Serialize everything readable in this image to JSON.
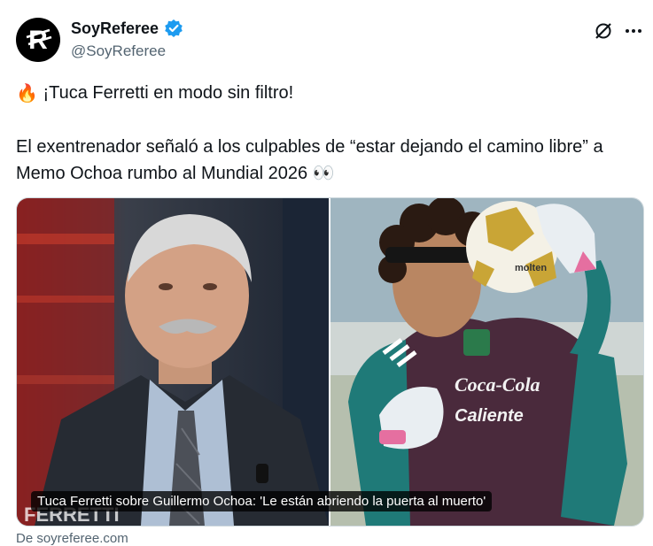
{
  "author": {
    "display_name": "SoyReferee",
    "handle": "@SoyReferee",
    "avatar_letter": "R",
    "verified": true,
    "verified_color": "#1d9bf0"
  },
  "actions": {
    "grok_icon": "grok-slash-icon",
    "more_icon": "more-horizontal-icon"
  },
  "tweet": {
    "line1": "¡Tuca Ferretti en modo sin filtro!",
    "line2": "El exentrenador señaló a los culpables de “estar dejando el camino libre” a Memo Ochoa rumbo al Mundial 2026",
    "emoji_fire": "🔥",
    "emoji_eyes": "👀"
  },
  "media": {
    "caption": "Tuca Ferretti sobre Guillermo Ochoa: 'Le están abriendo la puerta al muerto'",
    "left_image": "Tuca Ferretti speaking on TV set",
    "left_overlay_text": "FERRETTI",
    "right_image": "Guillermo Ochoa goalkeeper with ball in Mexico training kit",
    "jersey_text": "Coca-Cola",
    "jersey_sub": "Caliente",
    "ball_brand": "molten"
  },
  "source": "De soyreferee.com"
}
